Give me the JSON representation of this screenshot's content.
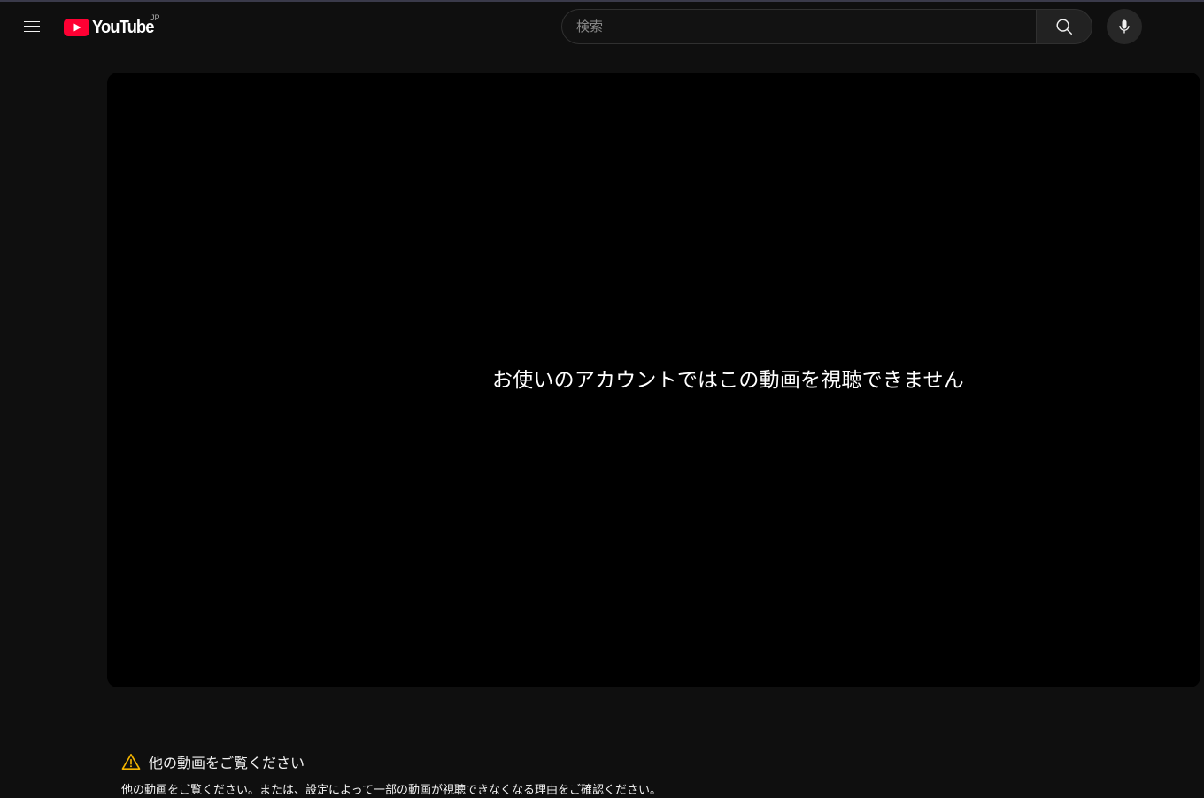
{
  "app": {
    "logo_text": "YouTube",
    "country_code": "JP",
    "brand_color": "#ff0033"
  },
  "header": {
    "menu_icon": "hamburger-menu-icon",
    "search": {
      "placeholder": "検索",
      "value": ""
    },
    "search_button_icon": "search-icon",
    "voice_search_icon": "microphone-icon"
  },
  "player": {
    "message": "お使いのアカウントではこの動画を視聴できません"
  },
  "notice": {
    "icon": "warning-icon",
    "icon_color": "#f4b400",
    "title": "他の動画をご覧ください",
    "body": "他の動画をご覧ください。または、設定によって一部の動画が視聴できなくなる理由をご確認ください。"
  }
}
